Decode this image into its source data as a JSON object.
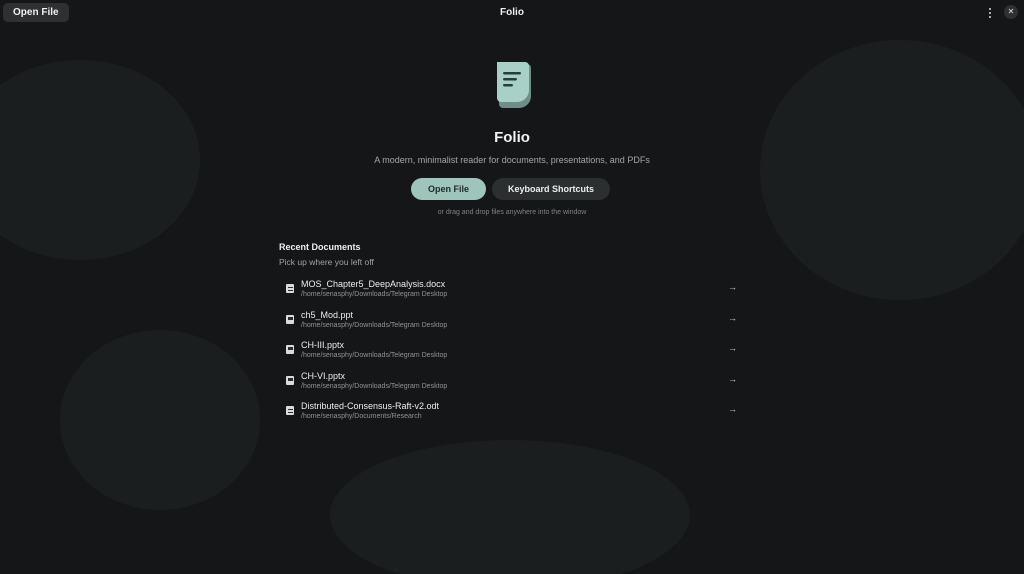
{
  "header": {
    "open_file_label": "Open File",
    "title": "Folio",
    "menu_icon": "vertical-ellipsis-icon",
    "close_icon": "close-icon",
    "close_glyph": "✕"
  },
  "hero": {
    "icon": "document-lines-icon",
    "icon_color": "#9ec4bb",
    "title": "Folio",
    "subtitle": "A modern, minimalist reader for documents, presentations, and PDFs",
    "primary_button": "Open File",
    "secondary_button": "Keyboard Shortcuts",
    "drop_hint": "or drag and drop files anywhere into the window"
  },
  "recent": {
    "title": "Recent Documents",
    "subtitle": "Pick up where you left off",
    "arrow_glyph": "→",
    "items": [
      {
        "name": "MOS_Chapter5_DeepAnalysis.docx",
        "path": "/home/senasphy/Downloads/Telegram Desktop",
        "icon": "text-document-icon"
      },
      {
        "name": "ch5_Mod.ppt",
        "path": "/home/senasphy/Downloads/Telegram Desktop",
        "icon": "presentation-icon"
      },
      {
        "name": "CH-III.pptx",
        "path": "/home/senasphy/Downloads/Telegram Desktop",
        "icon": "presentation-icon"
      },
      {
        "name": "CH-VI.pptx",
        "path": "/home/senasphy/Downloads/Telegram Desktop",
        "icon": "presentation-icon"
      },
      {
        "name": "Distributed-Consensus-Raft-v2.odt",
        "path": "/home/senasphy/Documents/Research",
        "icon": "text-document-icon"
      }
    ]
  },
  "colors": {
    "background": "#141617",
    "accent": "#9ec4bb",
    "secondary_button": "#2c2f30"
  }
}
